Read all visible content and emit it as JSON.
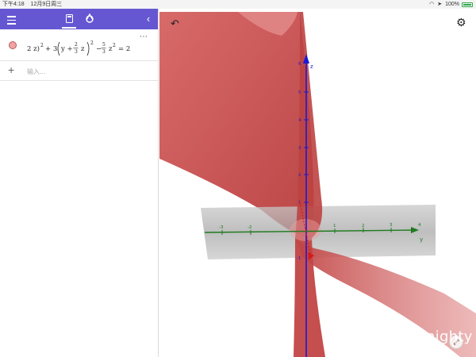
{
  "status_bar": {
    "time": "下午4:18",
    "date": "12月9日周三",
    "battery": "100%"
  },
  "algebra": {
    "equation": {
      "prefix": "2 z)",
      "pow1": "2",
      "plus3": "+ 3",
      "y": "y +",
      "frac1_num": "2",
      "frac1_den": "3",
      "z1": "z",
      "pow2": "2",
      "minus": "−",
      "frac2_num": "5",
      "frac2_den": "3",
      "z2": "z",
      "pow3": "2",
      "rhs": "= 2"
    },
    "more": "⋯",
    "input_placeholder": "输入..."
  },
  "axes": {
    "z_label": "z",
    "y_label": "y",
    "z_ticks": [
      "6",
      "5",
      "4",
      "3",
      "2",
      "1",
      "-1"
    ],
    "y_ticks": [
      "-3",
      "-2",
      "1",
      "2",
      "3",
      "4"
    ]
  },
  "colors": {
    "toolbar": "#6557d2",
    "surface": "#c94b4b",
    "z_axis": "#1a1ad4",
    "y_axis": "#1f7a1f",
    "x_axis": "#d41a1a"
  },
  "watermark": "知乎 @Almighty",
  "icons": {
    "menu": "menu-icon",
    "calculator": "calculator-icon",
    "tools": "tools-icon",
    "collapse": "chevron-left-icon",
    "undo": "undo-icon",
    "settings": "gear-icon",
    "add": "plus-icon",
    "fullscreen": "fullscreen-icon"
  }
}
